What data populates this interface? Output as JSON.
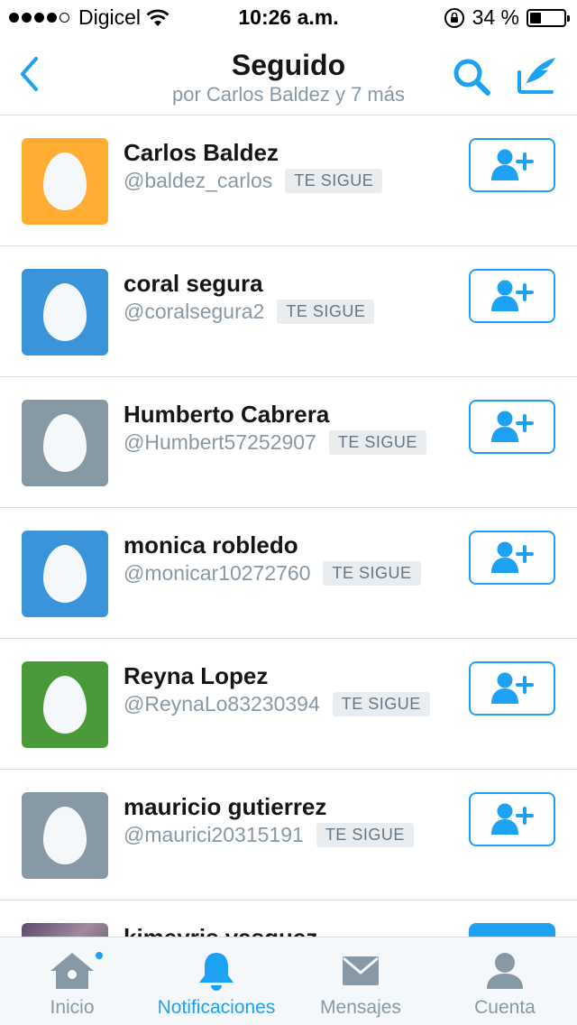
{
  "status_bar": {
    "carrier": "Digicel",
    "time": "10:26 a.m.",
    "battery_percent_label": "34 %",
    "battery_level": 0.34,
    "signal_bars": 4
  },
  "nav": {
    "title": "Seguido",
    "subtitle": "por Carlos Baldez y 7 más"
  },
  "badge_label": "TE SIGUE",
  "colors": {
    "accent": "#1da1f2",
    "avatar_orange": "#ffad33",
    "avatar_blue": "#3b94d9",
    "avatar_gray": "#8899a6",
    "avatar_green": "#4a9a3a"
  },
  "users": [
    {
      "name": "Carlos Baldez",
      "handle": "@baldez_carlos",
      "badge": "TE SIGUE",
      "avatar_color": "#ffad33"
    },
    {
      "name": "coral segura",
      "handle": "@coralsegura2",
      "badge": "TE SIGUE",
      "avatar_color": "#3b94d9"
    },
    {
      "name": "Humberto Cabrera",
      "handle": "@Humbert57252907",
      "badge": "TE SIGUE",
      "avatar_color": "#8899a6"
    },
    {
      "name": "monica robledo",
      "handle": "@monicar10272760",
      "badge": "TE SIGUE",
      "avatar_color": "#3b94d9"
    },
    {
      "name": "Reyna Lopez",
      "handle": "@ReynaLo83230394",
      "badge": "TE SIGUE",
      "avatar_color": "#4a9a3a"
    },
    {
      "name": "mauricio gutierrez",
      "handle": "@maurici20315191",
      "badge": "TE SIGUE",
      "avatar_color": "#8899a6"
    },
    {
      "name": "kimeyris vasquez",
      "handle": "",
      "badge": "",
      "avatar_color": "photo"
    }
  ],
  "tabs": [
    {
      "label": "Inicio",
      "icon": "home-icon",
      "active": false,
      "has_dot": true
    },
    {
      "label": "Notificaciones",
      "icon": "bell-icon",
      "active": true,
      "has_dot": false
    },
    {
      "label": "Mensajes",
      "icon": "envelope-icon",
      "active": false,
      "has_dot": false
    },
    {
      "label": "Cuenta",
      "icon": "person-icon",
      "active": false,
      "has_dot": false
    }
  ]
}
